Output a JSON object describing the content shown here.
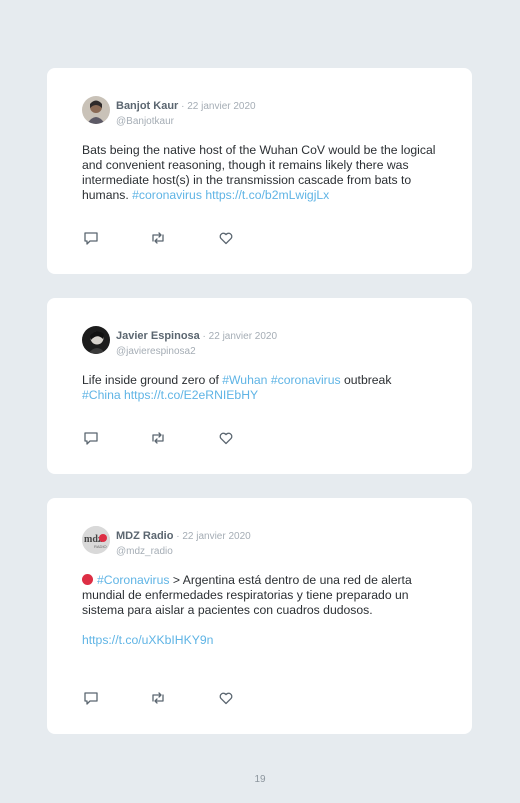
{
  "colors": {
    "background": "#e6ebef",
    "link": "#5fb4e5",
    "name": "#5b6670",
    "muted": "#a5adb5"
  },
  "tweets": [
    {
      "name": "Banjot Kaur",
      "date": " · 22 janvier 2020",
      "handle": "@Banjotkaur",
      "text": "Bats being the native host of the Wuhan CoV would be the logical and convenient reasoning, though it remains likely there was intermediate host(s) in the transmission cascade from bats to humans. ",
      "hashtag": "#coronavirus",
      "url": "https://t.co/b2mLwigjLx"
    },
    {
      "name": "Javier Espinosa",
      "date": " · 22 janvier 2020",
      "handle": "@javierespinosa2",
      "text_pre": "Life inside ground zero of ",
      "hashtag1": "#Wuhan",
      "hashtag2": "#coronavirus",
      "text_mid": " outbreak",
      "hashtag3": "#China",
      "url": "https://t.co/E2eRNIEbHY"
    },
    {
      "name": "MDZ Radio",
      "date": " · 22 janvier 2020",
      "handle": "@mdz_radio",
      "hashtag": "#Coronavirus",
      "text": " > Argentina está dentro de una red de alerta mundial de enfermedades respiratorias y tiene preparado un sistema para aislar a pacientes con cuadros dudosos.",
      "url": "https://t.co/uXKbIHKY9n",
      "avatar_text": "mdz",
      "avatar_sub": "RADIO"
    }
  ],
  "icons": [
    "reply-icon",
    "retweet-icon",
    "like-icon"
  ],
  "page_number": "19"
}
